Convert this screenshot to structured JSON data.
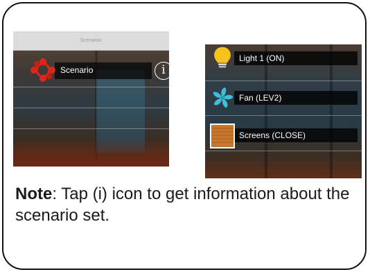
{
  "left_screen": {
    "nav_title": "Scenarios",
    "item_label": "Scenario",
    "info_glyph": "i"
  },
  "right_screen": {
    "devices": [
      {
        "label": "Light 1 (ON)",
        "icon": "light-bulb-icon"
      },
      {
        "label": "Fan (LEV2)",
        "icon": "fan-icon"
      },
      {
        "label": "Screens (CLOSE)",
        "icon": "screens-icon"
      }
    ]
  },
  "note": {
    "bold_label": "Note",
    "text": ": Tap (i) icon to get information about the scenario set."
  },
  "colors": {
    "scenario_icon": "#e0261b",
    "bulb": "#f6c21c",
    "fan": "#3fc0d8",
    "screens": "#c8782e"
  }
}
